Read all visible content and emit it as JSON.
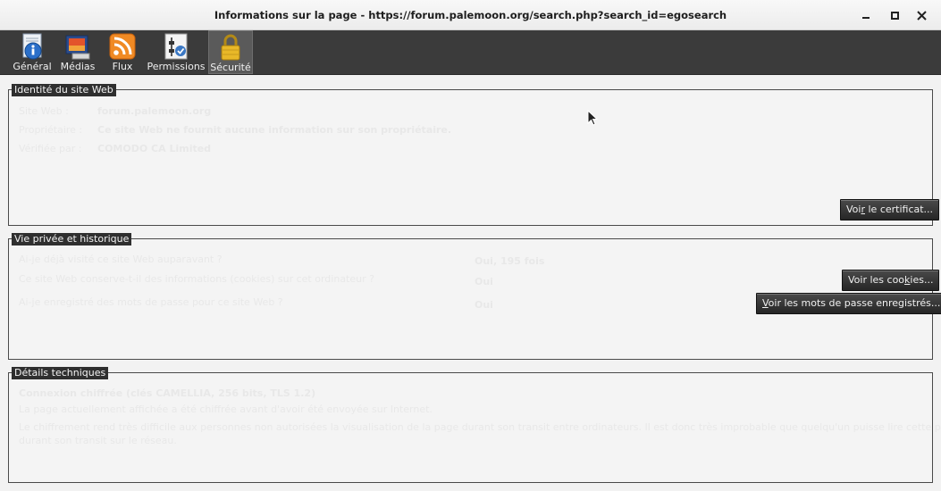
{
  "window": {
    "title": "Informations sur la page - https://forum.palemoon.org/search.php?search_id=egosearch"
  },
  "toolbar": {
    "tabs": [
      {
        "label": "Général",
        "icon": "info-icon"
      },
      {
        "label": "Médias",
        "icon": "media-icon"
      },
      {
        "label": "Flux",
        "icon": "rss-icon"
      },
      {
        "label": "Permissions",
        "icon": "permissions-icon"
      },
      {
        "label": "Sécurité",
        "icon": "lock-icon",
        "selected": true
      }
    ]
  },
  "identity": {
    "legend": "Identité du site Web",
    "rows": [
      {
        "label": "Site Web :",
        "value": "forum.palemoon.org"
      },
      {
        "label": "Propriétaire :",
        "value": "Ce site Web ne fournit aucune information sur son propriétaire."
      },
      {
        "label": "Vérifiée par :",
        "value": "COMODO CA Limited"
      }
    ],
    "cert_button": {
      "pre": "Voi",
      "accel": "r",
      "post": " le certificat..."
    }
  },
  "privacy": {
    "legend": "Vie privée et historique",
    "rows": [
      {
        "question": "Ai-je déjà visité ce site Web auparavant ?",
        "answer": "Oui, 195 fois"
      },
      {
        "question": "Ce site Web conserve-t-il des informations (cookies) sur cet ordinateur ?",
        "answer": "Oui"
      },
      {
        "question": "Ai-je enregistré des mots de passe pour ce site Web ?",
        "answer": "Oui"
      }
    ],
    "cookies_button": {
      "pre": "Voir les coo",
      "accel": "k",
      "post": "ies..."
    },
    "passwords_button": {
      "pre": "",
      "accel": "V",
      "post": "oir les mots de passe enregistrés..."
    }
  },
  "technical": {
    "legend": "Détails techniques",
    "headline": "Connexion chiffrée (clés CAMELLIA, 256 bits, TLS 1.2)",
    "line1": "La page actuellement affichée a été chiffrée avant d'avoir été envoyée sur Internet.",
    "line2a": "Le chiffrement rend très difficile aux personnes non autorisées la visualisation de la page durant son transit entre ordinateurs. Il est donc très improbable que quelqu'un puisse lire cette page",
    "line2b": "durant son transit sur le réseau."
  },
  "colors": {
    "toolbar_bg": "#3b3b3b",
    "legend_bg": "#2f2f2f",
    "button_bg": "#262626"
  }
}
